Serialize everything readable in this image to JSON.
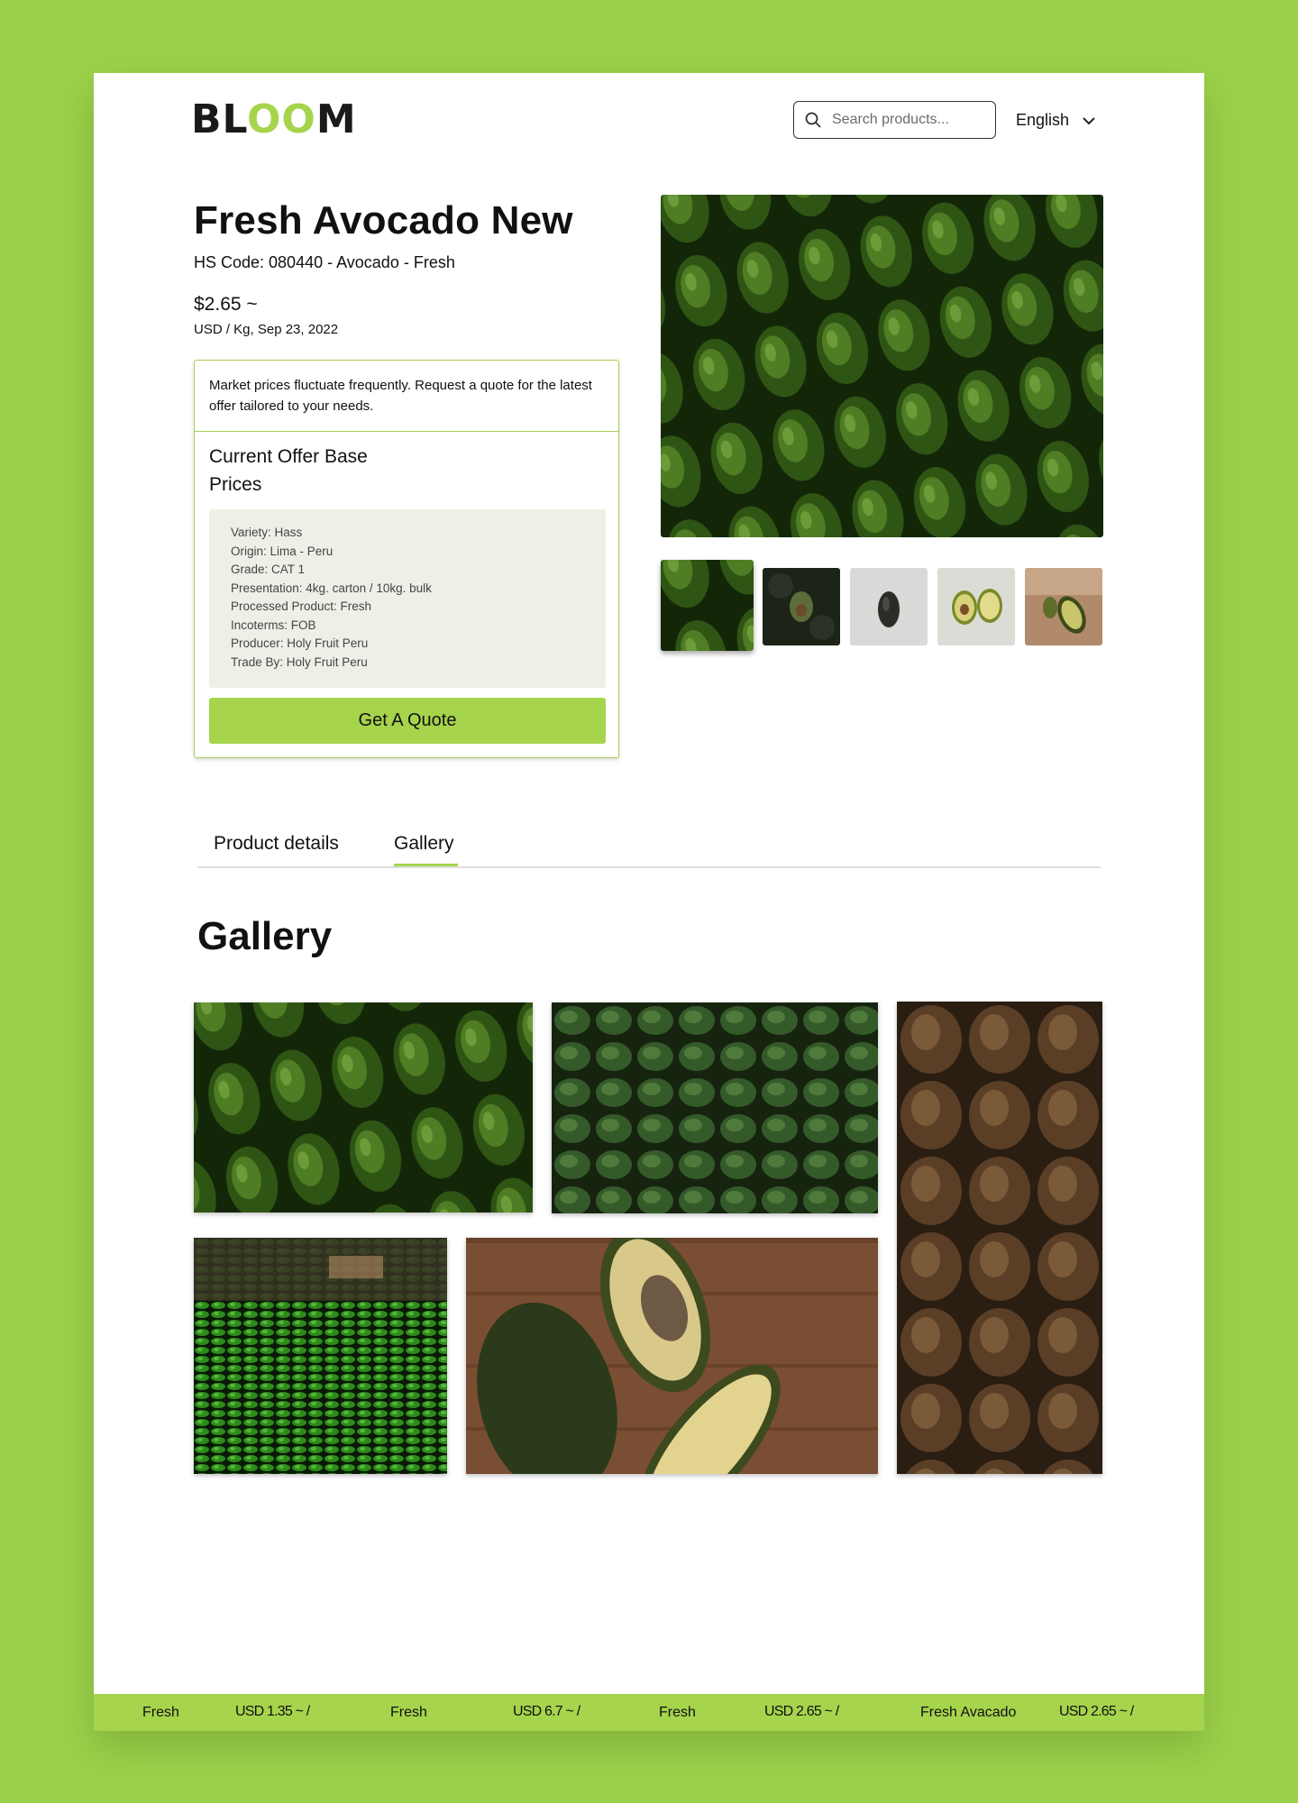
{
  "header": {
    "logo": {
      "part1": "BL",
      "part2": "OO",
      "part3": "M"
    },
    "search": {
      "placeholder": "Search products..."
    },
    "language": {
      "selected": "English"
    }
  },
  "product": {
    "title": "Fresh Avocado New",
    "hs_code": "HS Code: 080440 - Avocado - Fresh",
    "price": "$2.65 ~",
    "price_unit": "USD / Kg, Sep 23, 2022",
    "notice": "Market prices fluctuate frequently. Request a quote for the latest offer tailored to your needs.",
    "offer_title": "Current Offer Base Prices",
    "specs": [
      "Variety: Hass",
      "Origin: Lima - Peru",
      "Grade: CAT 1",
      "Presentation: 4kg. carton / 10kg. bulk",
      "Processed Product: Fresh",
      "Incoterms: FOB",
      "Producer: Holy Fruit Peru",
      "Trade By: Holy Fruit Peru"
    ],
    "quote_button": "Get A Quote"
  },
  "tabs": [
    {
      "label": "Product details",
      "active": false
    },
    {
      "label": "Gallery",
      "active": true
    }
  ],
  "gallery": {
    "title": "Gallery"
  },
  "ticker": [
    {
      "name": "Fresh",
      "price": "USD 1.35 ~ /"
    },
    {
      "name": "Fresh",
      "price": "USD 6.7 ~ /"
    },
    {
      "name": "Fresh",
      "price": "USD 2.65 ~ /"
    },
    {
      "name": "Fresh Avacado",
      "price": "USD 2.65 ~ /"
    }
  ],
  "colors": {
    "background": "#9bd14a",
    "accent": "#a6d44c",
    "spec_box": "#eef0e7",
    "avocado_dark": "#2f4f16",
    "avocado_mid": "#4f7d24"
  }
}
